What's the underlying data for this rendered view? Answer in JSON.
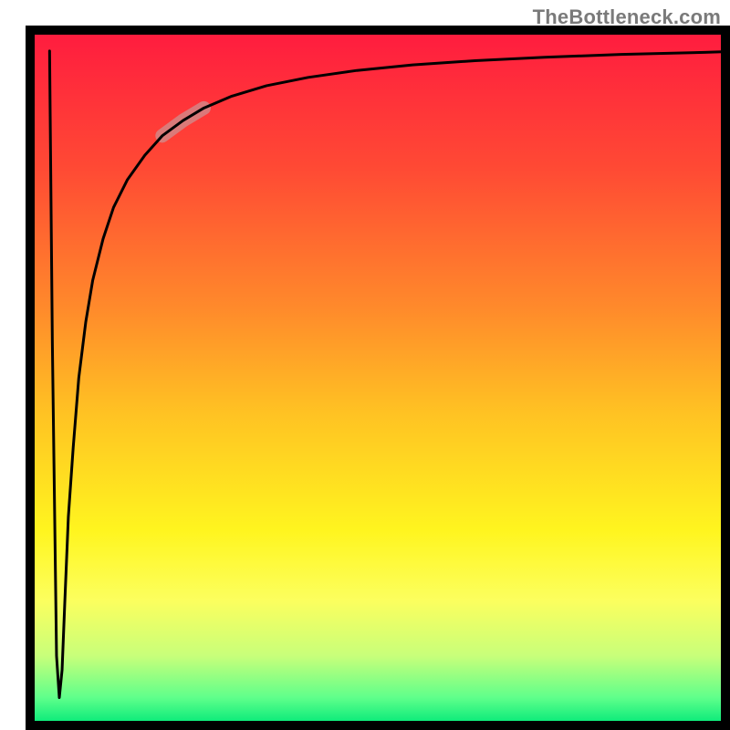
{
  "watermark": "TheBottleneck.com",
  "chart_data": {
    "type": "line",
    "title": "",
    "xlabel": "",
    "ylabel": "",
    "xlim": [
      0,
      100
    ],
    "ylim": [
      0,
      100
    ],
    "grid": false,
    "legend": false,
    "background_gradient": {
      "stops": [
        {
          "pos": 0.0,
          "color": "#ff1b3f"
        },
        {
          "pos": 0.2,
          "color": "#ff4a34"
        },
        {
          "pos": 0.4,
          "color": "#ff8a2b"
        },
        {
          "pos": 0.55,
          "color": "#ffc223"
        },
        {
          "pos": 0.72,
          "color": "#fff51f"
        },
        {
          "pos": 0.82,
          "color": "#fcff5e"
        },
        {
          "pos": 0.9,
          "color": "#c8ff7a"
        },
        {
          "pos": 0.96,
          "color": "#5fff8b"
        },
        {
          "pos": 1.0,
          "color": "#00e878"
        }
      ]
    },
    "series": [
      {
        "name": "curve",
        "stroke": "#000000",
        "x": [
          2.8,
          3.2,
          3.8,
          4.2,
          4.6,
          5.0,
          5.5,
          6.2,
          7.0,
          8.0,
          9.0,
          10.5,
          12.0,
          14.0,
          16.5,
          19.0,
          22.0,
          25.0,
          29.0,
          34.0,
          40.0,
          47.0,
          55.0,
          64.0,
          74.0,
          85.0,
          97.0,
          100.0
        ],
        "y": [
          97.0,
          55.0,
          10.0,
          4.0,
          8.0,
          18.0,
          30.0,
          40.0,
          50.0,
          58.0,
          64.0,
          70.0,
          74.5,
          78.5,
          82.0,
          84.8,
          87.0,
          88.8,
          90.5,
          92.0,
          93.2,
          94.2,
          95.0,
          95.6,
          96.1,
          96.5,
          96.8,
          96.9
        ]
      }
    ],
    "highlight_segment": {
      "x_from": 19.0,
      "x_to": 25.0,
      "color": "#cc9393",
      "opacity": 0.72,
      "width": 15
    }
  }
}
